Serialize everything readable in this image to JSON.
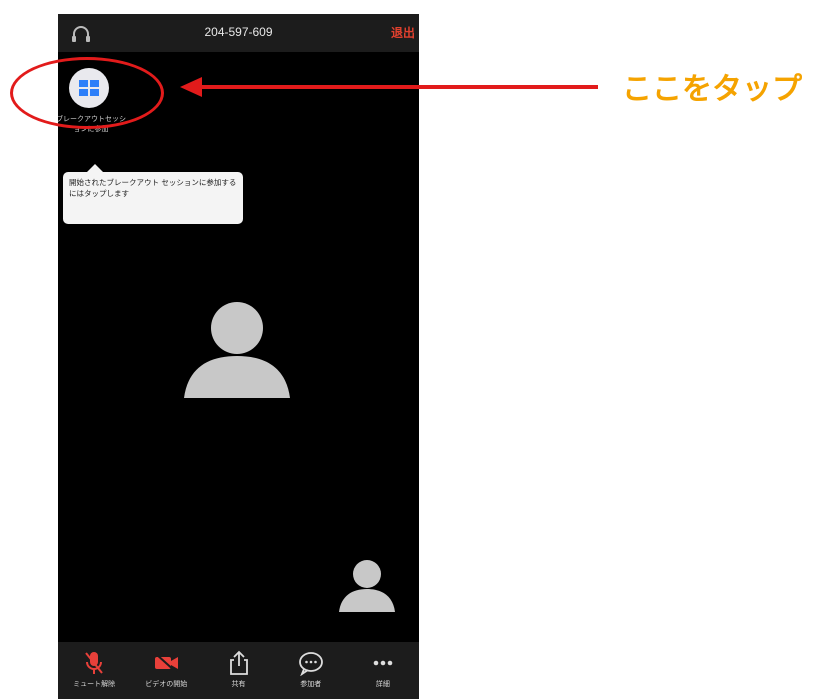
{
  "header": {
    "meeting_id": "204-597-609",
    "leave_label": "退出"
  },
  "breakout": {
    "button_label": "ブレークアウトセッションに参加",
    "tooltip": "開始されたブレークアウト セッションに参加するにはタップします"
  },
  "toolbar": [
    {
      "label": "ミュート解除",
      "icon": "muted-mic-icon"
    },
    {
      "label": "ビデオの開始",
      "icon": "video-off-icon"
    },
    {
      "label": "共有",
      "icon": "share-icon"
    },
    {
      "label": "参加者",
      "icon": "chat-bubble-icon"
    },
    {
      "label": "詳細",
      "icon": "more-icon"
    }
  ],
  "annotation": {
    "text": "ここをタップ"
  },
  "colors": {
    "accent_red": "#e21b1b",
    "annotation_orange": "#f5a300",
    "leave_red": "#e0402e"
  }
}
